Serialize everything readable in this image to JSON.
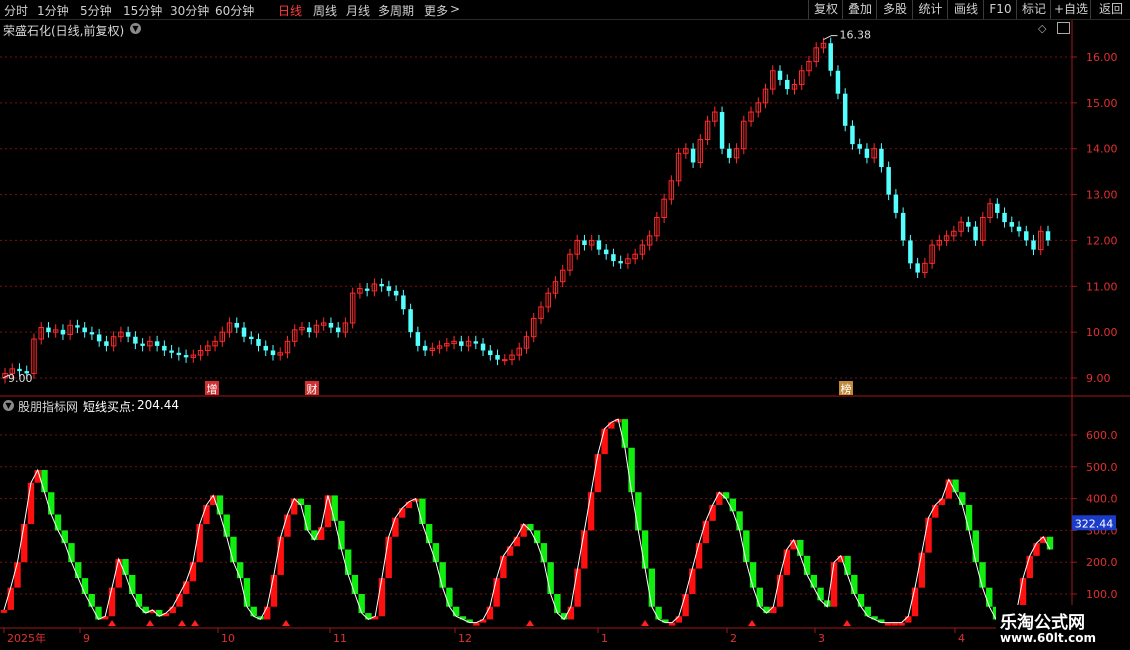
{
  "toolbar": {
    "periods": [
      "分时",
      "1分钟",
      "5分钟",
      "15分钟",
      "30分钟",
      "60分钟",
      "日线",
      "周线",
      "月线",
      "多周期",
      "更多"
    ],
    "active_period": "日线",
    "more_arrow": ">",
    "right_buttons": [
      "复权",
      "叠加",
      "多股",
      "统计",
      "画线",
      "F10",
      "标记",
      "+自选",
      "返回"
    ]
  },
  "main_panel": {
    "title": "荣盛石化(日线,前复权)",
    "high_label": "16.38",
    "low_label": "9.00",
    "events": [
      "增",
      "财",
      "榜"
    ],
    "price_ticks": [
      "16.00",
      "15.00",
      "14.00",
      "13.00",
      "12.00",
      "11.00",
      "10.00",
      "9.00"
    ]
  },
  "indicator_panel": {
    "name": "股朋指标网",
    "line_label": "短线买点:",
    "line_value": "204.44",
    "ticks": [
      "600.0",
      "500.0",
      "400.0",
      "300.0",
      "200.0",
      "100.0"
    ],
    "current_badge": "322.44"
  },
  "date_axis": [
    "2025年",
    "9",
    "10",
    "11",
    "12",
    "1",
    "2",
    "3",
    "4"
  ],
  "watermark": {
    "line1": "乐淘公式网",
    "line2": "www.60lt.com"
  },
  "colors": {
    "up": "#ff2a2a",
    "down": "#54ffff",
    "ind_up": "#ff1010",
    "ind_down": "#10ee10",
    "grid": "#7a1010",
    "axis": "#a01818"
  },
  "chart_data": [
    {
      "type": "candlestick",
      "title": "荣盛石化(日线,前复权)",
      "yrange": [
        8.8,
        16.8
      ],
      "closes": [
        9.1,
        9.2,
        9.15,
        9.1,
        9.85,
        10.1,
        10.0,
        10.05,
        9.95,
        10.15,
        10.1,
        10.0,
        9.95,
        9.8,
        9.7,
        9.9,
        10.0,
        9.9,
        9.75,
        9.7,
        9.8,
        9.7,
        9.6,
        9.55,
        9.5,
        9.45,
        9.5,
        9.6,
        9.7,
        9.8,
        10.0,
        10.2,
        10.1,
        9.9,
        9.85,
        9.7,
        9.6,
        9.5,
        9.55,
        9.8,
        10.05,
        10.1,
        10.0,
        10.15,
        10.2,
        10.1,
        10.0,
        10.2,
        10.85,
        10.95,
        10.9,
        11.05,
        11.0,
        10.9,
        10.8,
        10.5,
        10.0,
        9.7,
        9.6,
        9.65,
        9.7,
        9.75,
        9.8,
        9.7,
        9.8,
        9.75,
        9.6,
        9.5,
        9.4,
        9.4,
        9.5,
        9.65,
        9.9,
        10.3,
        10.55,
        10.85,
        11.1,
        11.35,
        11.7,
        12.0,
        11.9,
        12.0,
        11.8,
        11.7,
        11.55,
        11.5,
        11.6,
        11.7,
        11.9,
        12.1,
        12.5,
        12.9,
        13.3,
        13.9,
        14.0,
        13.7,
        14.2,
        14.6,
        14.8,
        14.0,
        13.8,
        14.0,
        14.6,
        14.8,
        15.0,
        15.3,
        15.7,
        15.5,
        15.3,
        15.4,
        15.7,
        15.9,
        16.2,
        16.3,
        15.7,
        15.2,
        14.5,
        14.1,
        14.0,
        13.8,
        14.0,
        13.6,
        13.0,
        12.6,
        12.0,
        11.5,
        11.3,
        11.5,
        11.9,
        12.0,
        12.1,
        12.2,
        12.4,
        12.3,
        12.0,
        12.5,
        12.8,
        12.6,
        12.4,
        12.3,
        12.2,
        12.0,
        11.8,
        12.2,
        12.0
      ],
      "opens": [
        9.0,
        9.1,
        9.2,
        9.15,
        9.1,
        9.85,
        10.1,
        10.0,
        10.05,
        9.95,
        10.15,
        10.1,
        10.0,
        9.95,
        9.8,
        9.7,
        9.9,
        10.0,
        9.9,
        9.75,
        9.7,
        9.8,
        9.7,
        9.6,
        9.55,
        9.5,
        9.45,
        9.5,
        9.6,
        9.7,
        9.8,
        10.0,
        10.2,
        10.1,
        9.9,
        9.85,
        9.7,
        9.6,
        9.5,
        9.55,
        9.8,
        10.05,
        10.1,
        10.0,
        10.15,
        10.2,
        10.1,
        10.0,
        10.2,
        10.85,
        10.95,
        10.9,
        11.05,
        11.0,
        10.9,
        10.8,
        10.5,
        10.0,
        9.7,
        9.6,
        9.65,
        9.7,
        9.75,
        9.8,
        9.7,
        9.8,
        9.75,
        9.6,
        9.5,
        9.4,
        9.4,
        9.5,
        9.65,
        9.9,
        10.3,
        10.55,
        10.85,
        11.1,
        11.35,
        11.7,
        12.0,
        11.9,
        12.0,
        11.8,
        11.7,
        11.55,
        11.5,
        11.6,
        11.7,
        11.9,
        12.1,
        12.5,
        12.9,
        13.3,
        13.9,
        14.0,
        13.7,
        14.2,
        14.6,
        14.8,
        14.0,
        13.8,
        14.0,
        14.6,
        14.8,
        15.0,
        15.3,
        15.7,
        15.5,
        15.3,
        15.4,
        15.7,
        15.9,
        16.2,
        16.3,
        15.7,
        15.2,
        14.5,
        14.1,
        14.0,
        13.8,
        14.0,
        13.6,
        13.0,
        12.6,
        12.0,
        11.5,
        11.3,
        11.5,
        11.9,
        12.0,
        12.1,
        12.2,
        12.4,
        12.3,
        12.0,
        12.5,
        12.8,
        12.6,
        12.4,
        12.3,
        12.2,
        12.0,
        11.8,
        12.2
      ]
    },
    {
      "type": "bar",
      "title": "股朋指标网",
      "series_name": "短线买点",
      "yrange": [
        0,
        700
      ],
      "values": [
        50,
        120,
        200,
        320,
        450,
        490,
        420,
        350,
        300,
        260,
        200,
        150,
        100,
        60,
        20,
        30,
        120,
        210,
        160,
        100,
        60,
        40,
        50,
        30,
        40,
        60,
        100,
        140,
        200,
        320,
        380,
        410,
        350,
        280,
        200,
        150,
        60,
        30,
        20,
        60,
        160,
        280,
        350,
        400,
        380,
        300,
        270,
        310,
        410,
        330,
        240,
        160,
        100,
        40,
        20,
        30,
        150,
        280,
        340,
        370,
        390,
        400,
        320,
        260,
        200,
        120,
        60,
        30,
        20,
        10,
        10,
        20,
        60,
        150,
        220,
        250,
        280,
        320,
        300,
        260,
        200,
        100,
        40,
        20,
        60,
        180,
        300,
        420,
        540,
        620,
        640,
        650,
        560,
        420,
        300,
        180,
        60,
        20,
        10,
        10,
        30,
        100,
        180,
        260,
        330,
        380,
        420,
        400,
        360,
        300,
        200,
        120,
        60,
        40,
        60,
        160,
        240,
        270,
        220,
        160,
        120,
        80,
        60,
        200,
        220,
        160,
        100,
        60,
        30,
        20,
        10,
        10,
        10,
        10,
        30,
        120,
        230,
        340,
        380,
        400,
        460,
        420,
        380,
        300,
        200,
        120,
        60,
        20,
        10,
        20,
        40,
        150,
        220,
        260,
        280,
        240
      ],
      "current": 322.44
    }
  ]
}
